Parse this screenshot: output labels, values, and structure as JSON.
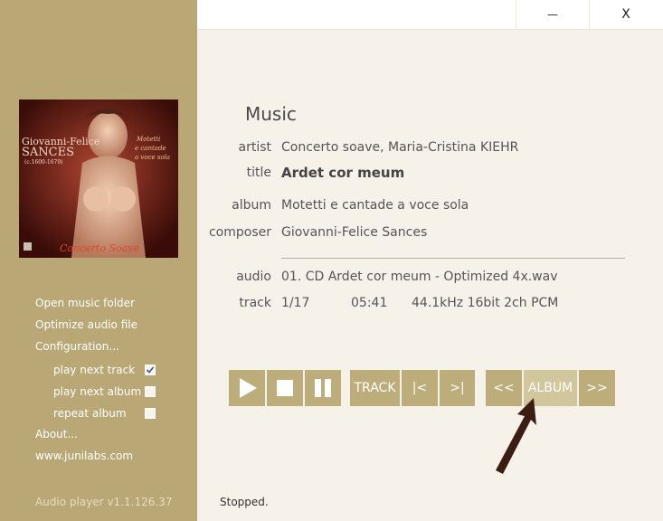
{
  "window": {
    "minimize_label": "—",
    "close_label": "X"
  },
  "album_cover": {
    "artist_line1": "Giovanni-Felice",
    "artist_line2": "SANCES",
    "years": "(c.1600-1679)",
    "subtitle_line1": "Motetti",
    "subtitle_line2": "e cantade",
    "subtitle_line3": "a voce sola",
    "ensemble": "Concerto Soave"
  },
  "sidebar": {
    "open_folder": "Open music folder",
    "optimize": "Optimize audio file",
    "configuration": "Configuration...",
    "options": [
      {
        "label": "play next track",
        "checked": true
      },
      {
        "label": "play next album",
        "checked": false
      },
      {
        "label": "repeat album",
        "checked": false
      }
    ],
    "about": "About...",
    "website": "www.junilabs.com",
    "version": "Audio player v1.1.126.37"
  },
  "info": {
    "heading": "Music",
    "artist_label": "artist",
    "artist": "Concerto soave, Maria-Cristina KIEHR",
    "title_label": "title",
    "title": "Ardet cor meum",
    "album_label": "album",
    "album": "Motetti e cantade a voce sola",
    "composer_label": "composer",
    "composer": "Giovanni-Felice Sances",
    "audio_label": "audio",
    "audio": "01. CD Ardet cor meum - Optimized 4x.wav",
    "track_label": "track",
    "track_number": "1/17",
    "duration": "05:41",
    "format": "44.1kHz 16bit 2ch PCM"
  },
  "controls": {
    "play_icon": "play-icon",
    "stop_icon": "stop-icon",
    "pause_icon": "pause-icon",
    "track_label": "TRACK",
    "prev_track": "|<",
    "next_track": ">|",
    "prev_album": "<<",
    "album_label": "ALBUM",
    "next_album": ">>"
  },
  "status": "Stopped.",
  "colors": {
    "sidebar": "#b9a776",
    "button": "#bdad7a",
    "button_highlight": "#d2c79c",
    "background": "#f7f2e9",
    "arrow": "#3b1d12"
  }
}
